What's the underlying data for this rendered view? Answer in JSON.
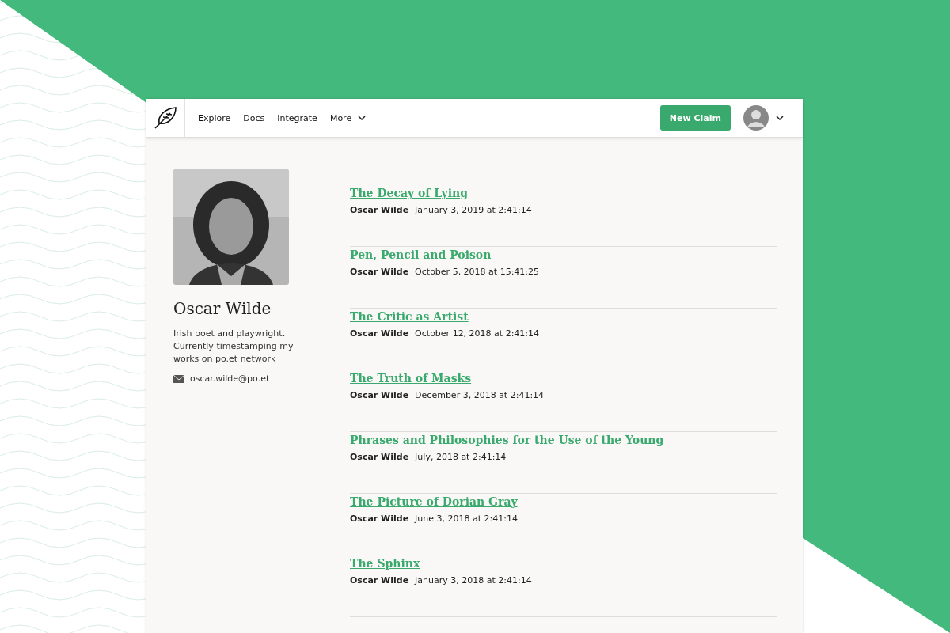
{
  "nav": {
    "links": [
      {
        "label": "Explore"
      },
      {
        "label": "Docs"
      },
      {
        "label": "Integrate"
      },
      {
        "label": "More",
        "dropdown": true
      }
    ],
    "button": "New Claim"
  },
  "profile": {
    "name": "Oscar Wilde",
    "bio": "Irish poet and playwright. Currently timestamping my works on po.et network",
    "email": "oscar.wilde@po.et"
  },
  "works": [
    {
      "title": "The Decay of Lying",
      "author": "Oscar Wilde",
      "date": "January 3, 2019 at 2:41:14"
    },
    {
      "title": "Pen, Pencil and Poison",
      "author": "Oscar Wilde",
      "date": "October 5, 2018 at 15:41:25"
    },
    {
      "title": "The Critic as Artist",
      "author": "Oscar Wilde",
      "date": "October 12, 2018 at 2:41:14"
    },
    {
      "title": "The Truth of Masks",
      "author": "Oscar Wilde",
      "date": "December 3, 2018 at 2:41:14"
    },
    {
      "title": "Phrases and Philosophies for the Use of the Young",
      "author": "Oscar Wilde",
      "date": "July, 2018 at 2:41:14"
    },
    {
      "title": "The Picture of Dorian Gray",
      "author": "Oscar Wilde",
      "date": "June 3, 2018 at 2:41:14"
    },
    {
      "title": "The Sphinx",
      "author": "Oscar Wilde",
      "date": "January 3, 2018 at 2:41:14"
    }
  ]
}
